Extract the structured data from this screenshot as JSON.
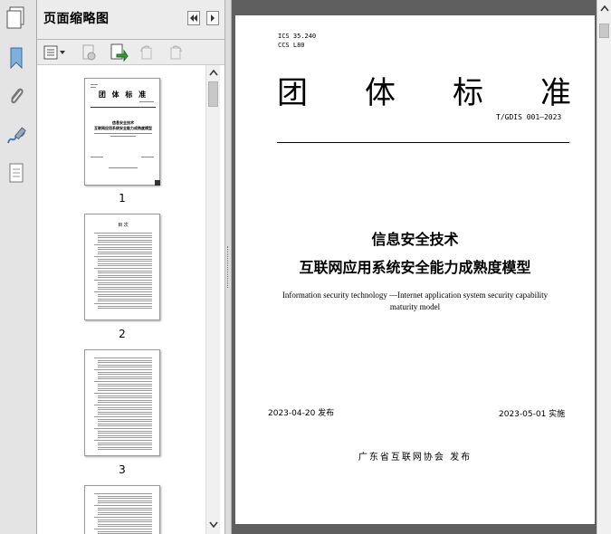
{
  "panel": {
    "title": "页面缩略图",
    "thumbnails": [
      {
        "label": "1"
      },
      {
        "label": "2"
      },
      {
        "label": "3"
      }
    ],
    "thumb1": {
      "heading": "团 体 标 准",
      "title1": "信息安全技术",
      "title2": "互联网应用系统安全能力成熟度模型"
    },
    "thumb2": {
      "heading": "目 次"
    }
  },
  "document": {
    "codes": [
      "ICS 35.240",
      "CCS L80"
    ],
    "standard_type": "团  体  标  准",
    "standard_number": "T/GDIS 001—2023",
    "title_cn_line1": "信息安全技术",
    "title_cn_line2": "互联网应用系统安全能力成熟度模型",
    "title_en_line1": "Information security technology —Internet application system security capability",
    "title_en_line2": "maturity model",
    "publish_date": "2023-04-20 发布",
    "implement_date": "2023-05-01 实施",
    "issuer": "广东省互联网协会   发布"
  },
  "colors": {
    "doc_background": "#5f5f5f",
    "panel_background": "#ececec"
  }
}
